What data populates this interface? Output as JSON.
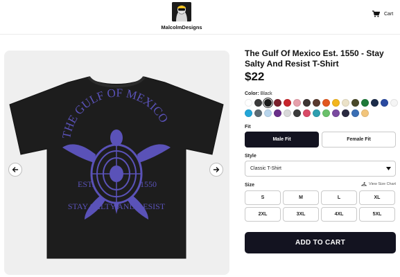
{
  "header": {
    "shop_name": "MalcolmDesigns",
    "cart_label": "Cart"
  },
  "product": {
    "title": "The Gulf Of Mexico Est. 1550 - Stay Salty And Resist T-Shirt",
    "price": "$22",
    "print": {
      "top_text": "THE GULF OF MEXICO",
      "est_label": "EST.",
      "year": "1550",
      "bottom_text": "STAY SALTY AND RESIST",
      "ink_color": "#5a52b8",
      "shirt_color": "#1d1d1d"
    }
  },
  "color": {
    "label": "Color:",
    "selected": "Black",
    "swatches": [
      {
        "hex": "#ffffff"
      },
      {
        "hex": "#3a3a3a"
      },
      {
        "hex": "#1a1a1a",
        "selected": true
      },
      {
        "hex": "#7a1f2b"
      },
      {
        "hex": "#c8252c"
      },
      {
        "hex": "#e6a0ab"
      },
      {
        "hex": "#3d3533"
      },
      {
        "hex": "#5a3a2e"
      },
      {
        "hex": "#e2571e"
      },
      {
        "hex": "#f2b61e"
      },
      {
        "hex": "#ebe2c8"
      },
      {
        "hex": "#4a4a2a"
      },
      {
        "hex": "#1f7a3a"
      },
      {
        "hex": "#1c2c4a"
      },
      {
        "hex": "#2a4aa0"
      },
      {
        "hex": "#f5f5f5"
      },
      {
        "hex": "#23a6d8"
      },
      {
        "hex": "#5e6b73"
      },
      {
        "hex": "#b8d5ec"
      },
      {
        "hex": "#6a2f8a"
      },
      {
        "hex": "#d9d9d9"
      },
      {
        "hex": "#3b3b3b"
      },
      {
        "hex": "#d94a66"
      },
      {
        "hex": "#2e9fb0"
      },
      {
        "hex": "#6ac06a"
      },
      {
        "hex": "#7b4aa0"
      },
      {
        "hex": "#2a2a40"
      },
      {
        "hex": "#3a6fb5"
      },
      {
        "hex": "#f2c57c"
      }
    ]
  },
  "fit": {
    "label": "Fit",
    "options": [
      "Male Fit",
      "Female Fit"
    ],
    "active": "Male Fit"
  },
  "style": {
    "label": "Style",
    "value": "Classic T-Shirt"
  },
  "size": {
    "label": "Size",
    "guide_label": "View Size Chart",
    "options": [
      "S",
      "M",
      "L",
      "XL",
      "2XL",
      "3XL",
      "4XL",
      "5XL"
    ]
  },
  "cta": {
    "add_to_cart": "ADD TO CART"
  }
}
